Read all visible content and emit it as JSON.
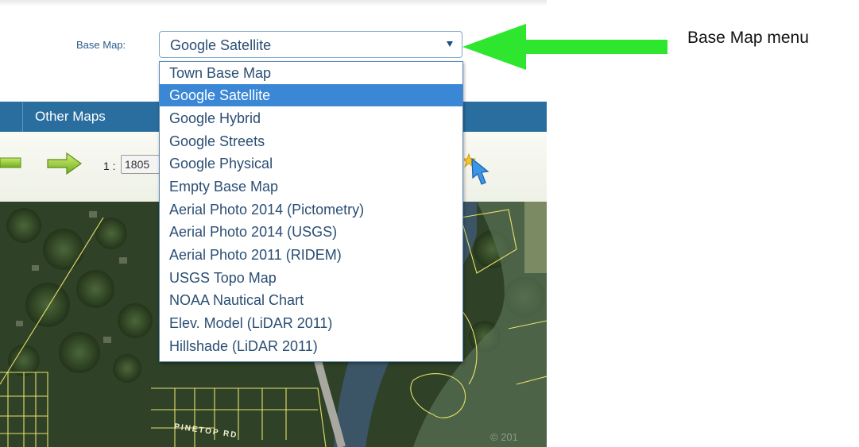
{
  "basemap": {
    "label": "Base Map:",
    "selected": "Google Satellite",
    "options": [
      "Town Base Map",
      "Google Satellite",
      "Google Hybrid",
      "Google Streets",
      "Google Physical",
      "Empty Base Map",
      "Aerial Photo 2014 (Pictometry)",
      "Aerial Photo 2014 (USGS)",
      "Aerial Photo 2011 (RIDEM)",
      "USGS Topo Map",
      "NOAA Nautical Chart",
      "Elev. Model (LiDAR 2011)",
      "Hillshade (LiDAR 2011)"
    ],
    "highlight_color": "#3a87d6"
  },
  "tabs": {
    "other_maps": "Other Maps"
  },
  "toolbar": {
    "scale_prefix": "1 :",
    "scale_value": "1805",
    "icons": [
      "pan-left-arrow-icon",
      "pan-right-arrow-icon",
      "select-pointer-icon"
    ]
  },
  "map": {
    "road_label": "PINETOP RD",
    "copyright": "© 201"
  },
  "annotation": {
    "text": "Base Map menu",
    "arrow_color": "#2ee62e"
  }
}
